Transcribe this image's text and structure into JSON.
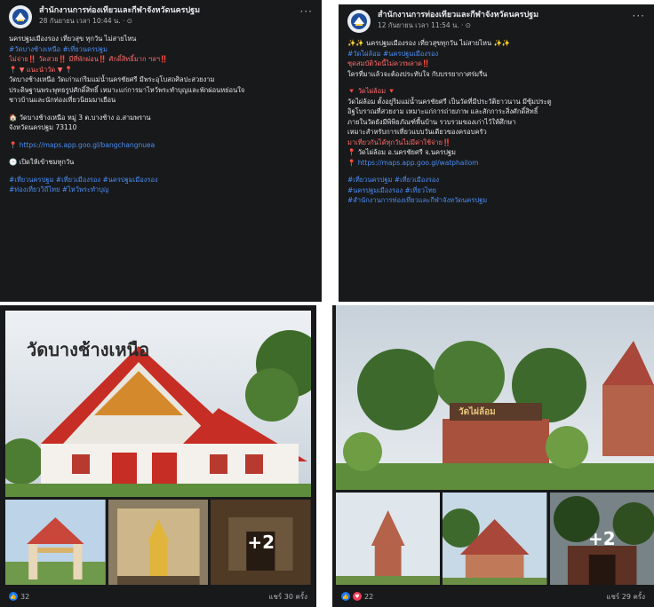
{
  "colors": {
    "panel_bg": "#18191a",
    "link": "#4b8df5",
    "like": "#1877f2",
    "love": "#f33e58",
    "text": "#e4e6eb"
  },
  "post1": {
    "page_name": "สำนักงานการท่องเที่ยวและกีฬาจังหวัดนครปฐม",
    "meta": "28 กันยายน เวลา 10:44 น. · ⊙",
    "more": "···",
    "lines": [
      "นครปฐมเมืองรอง เที่ยวสุข ทุกวัน ไม่สายไหน",
      "#วัดบางช้างเหนือ #เที่ยวนครปฐม",
      "ไม่จ่าย‼️ วัดสวย‼️ มีที่พักผ่อน‼️ ศักดิ์สิทธิ์มาก ฯลฯ‼️",
      "📍 ▼ แนะนำวัด ▼ 📍",
      "วัดบางช้างเหนือ วัดเก่าแก่ริมแม่น้ำนครชัยศรี มีพระอุโบสถศิลปะสวยงาม",
      "ประดิษฐานพระพุทธรูปศักดิ์สิทธิ์ เหมาะแก่การมาไหว้พระทำบุญและพักผ่อนหย่อนใจ",
      "ชาวบ้านและนักท่องเที่ยวนิยมมาเยือน",
      "",
      "🏠 วัดบางช้างเหนือ หมู่ 3 ต.บางช้าง อ.สามพราน",
      "จังหวัดนครปฐม 73110",
      "",
      "📍 https://maps.app.goo.gl/bangchangnuea",
      "",
      "🕒 เปิดให้เข้าชมทุกวัน",
      "",
      "#เที่ยวนครปฐม #เที่ยวเมืองรอง #นครปฐมเมืองรอง",
      "#ท่องเที่ยววิถีไทย #ไหว้พระทำบุญ"
    ],
    "link_lines": [
      1,
      11,
      15,
      16
    ],
    "red_lines": [
      2,
      3
    ],
    "photo_title": "วัดบางช้างเหนือ",
    "plus_more": "+2",
    "reaction_count": "32",
    "comments_shares": "แชร์ 30 ครั้ง"
  },
  "post2": {
    "page_name": "สำนักงานการท่องเที่ยวและกีฬาจังหวัดนครปฐม",
    "meta": "12 กันยายน เวลา 11:54 น. · ⊙",
    "more": "···",
    "lines": [
      "✨✨ นครปฐมเมืองรอง เที่ยวสุขทุกวัน ไม่สายไหน ✨✨",
      "#วัดไผ่ล้อม #นครปฐมเมืองรอง",
      "ชุดสมบัติวัดนี้ไม่ควรพลาด‼️",
      "ใครที่มาแล้วจะต้องประทับใจ กับบรรยากาศร่มรื่น",
      "",
      "🔻 วัดไผ่ล้อม 🔻",
      "วัดไผ่ล้อม ตั้งอยู่ริมแม่น้ำนครชัยศรี เป็นวัดที่มีประวัติยาวนาน มีซุ้มประตู",
      "อิฐโบราณที่สวยงาม เหมาะแก่การถ่ายภาพ และสักการะสิ่งศักดิ์สิทธิ์",
      "ภายในวัดยังมีพิพิธภัณฑ์พื้นบ้าน รวบรวมของเก่าไว้ให้ศึกษา",
      "เหมาะสำหรับการเที่ยวแบบวันเดียวของครอบครัว",
      "มาเที่ยวกันได้ทุกวันไม่มีค่าใช้จ่าย‼️",
      "📍 วัดไผ่ล้อม อ.นครชัยศรี จ.นครปฐม",
      "📍 https://maps.app.goo.gl/watphailom",
      "",
      "#เที่ยวนครปฐม #เที่ยวเมืองรอง",
      "#นครปฐมเมืองรอง #เที่ยวไทย",
      "#สำนักงานการท่องเที่ยวและกีฬาจังหวัดนครปฐม"
    ],
    "link_lines": [
      1,
      12,
      14,
      15,
      16
    ],
    "red_lines": [
      2,
      5,
      10
    ],
    "photo_sign": "วัดไผ่ล้อม",
    "plus_more": "+2",
    "reaction_count": "22",
    "comments_shares": "แชร์ 29 ครั้ง"
  }
}
